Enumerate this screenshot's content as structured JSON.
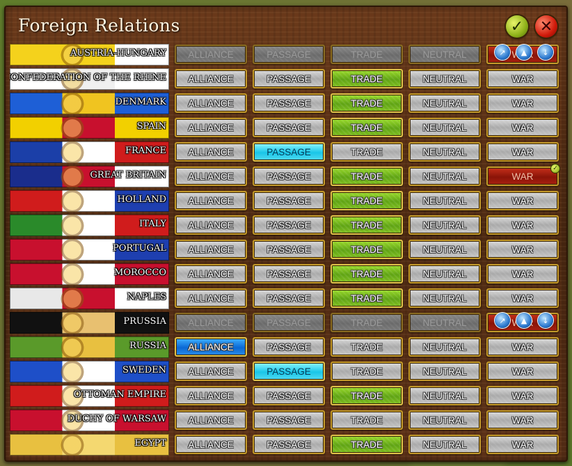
{
  "window": {
    "title": "Foreign Relations",
    "ok_icon": "checkmark-icon",
    "close_icon": "close-x-icon"
  },
  "columns": [
    "ALLIANCE",
    "PASSAGE",
    "TRADE",
    "NEUTRAL",
    "WAR"
  ],
  "colors": {
    "trade_active": "#5fa314",
    "passage_active": "#19c6e8",
    "alliance_active": "#0a68d4",
    "war_active": "#8a1408",
    "inactive": "#a9a9a9"
  },
  "nations": [
    {
      "name": "AUSTRIA-HUNGARY",
      "flag": [
        "#f4d21c",
        "#f4d21c",
        "#ffffff"
      ],
      "states": [
        "disabled",
        "disabled",
        "disabled",
        "disabled",
        "war-icons"
      ]
    },
    {
      "name": "CONFEDERATION OF THE RHINE",
      "flag": [
        "#ffffff",
        "#f0f0f0",
        "#ffffff"
      ],
      "states": [
        "off",
        "off",
        "green",
        "off",
        "off"
      ]
    },
    {
      "name": "DENMARK",
      "flag": [
        "#1e5fd6",
        "#f0c420",
        "#1e5fd6"
      ],
      "states": [
        "off",
        "off",
        "green",
        "off",
        "off"
      ]
    },
    {
      "name": "SPAIN",
      "flag": [
        "#f2d000",
        "#c8102e",
        "#f2d000"
      ],
      "states": [
        "off",
        "off",
        "green",
        "off",
        "off"
      ]
    },
    {
      "name": "FRANCE",
      "flag": [
        "#1b3fa8",
        "#ffffff",
        "#d01c1c"
      ],
      "states": [
        "off",
        "cyan",
        "off",
        "off",
        "off"
      ]
    },
    {
      "name": "GREAT BRITAIN",
      "flag": [
        "#1a2d8c",
        "#c8102e",
        "#ffffff"
      ],
      "states": [
        "off",
        "off",
        "green",
        "off",
        "red"
      ]
    },
    {
      "name": "HOLLAND",
      "flag": [
        "#d01c1c",
        "#ffffff",
        "#1e3fb0"
      ],
      "states": [
        "off",
        "off",
        "green",
        "off",
        "off"
      ]
    },
    {
      "name": "ITALY",
      "flag": [
        "#2a8a2a",
        "#ffffff",
        "#d01c1c"
      ],
      "states": [
        "off",
        "off",
        "green",
        "off",
        "off"
      ]
    },
    {
      "name": "PORTUGAL",
      "flag": [
        "#c8102e",
        "#ffffff",
        "#1e3fb0"
      ],
      "states": [
        "off",
        "off",
        "green",
        "off",
        "off"
      ]
    },
    {
      "name": "MOROCCO",
      "flag": [
        "#c8102e",
        "#ffffff",
        "#c8102e"
      ],
      "states": [
        "off",
        "off",
        "green",
        "off",
        "off"
      ]
    },
    {
      "name": "NAPLES",
      "flag": [
        "#e8e8e8",
        "#c8102e",
        "#ffffff"
      ],
      "states": [
        "off",
        "off",
        "green",
        "off",
        "off"
      ]
    },
    {
      "name": "PRUSSIA",
      "flag": [
        "#111111",
        "#e8c070",
        "#111111"
      ],
      "states": [
        "disabled",
        "disabled",
        "disabled",
        "disabled",
        "war-icons"
      ]
    },
    {
      "name": "RUSSIA",
      "flag": [
        "#5a9a2a",
        "#e8c040",
        "#5a9a2a"
      ],
      "states": [
        "blue",
        "off",
        "off",
        "off",
        "off"
      ]
    },
    {
      "name": "SWEDEN",
      "flag": [
        "#1e4fc8",
        "#ffffff",
        "#1e4fc8"
      ],
      "states": [
        "off",
        "cyan",
        "off",
        "off",
        "off"
      ]
    },
    {
      "name": "OTTOMAN EMPIRE",
      "flag": [
        "#d01c1c",
        "#ffffff",
        "#d01c1c"
      ],
      "states": [
        "off",
        "off",
        "green",
        "off",
        "off"
      ]
    },
    {
      "name": "DUCHY OF WARSAW",
      "flag": [
        "#c8102e",
        "#ffffff",
        "#c8102e"
      ],
      "states": [
        "off",
        "off",
        "off",
        "off",
        "off"
      ]
    },
    {
      "name": "EGYPT",
      "flag": [
        "#e8c040",
        "#f4d870",
        "#e8c040"
      ],
      "states": [
        "off",
        "off",
        "green",
        "off",
        "off"
      ]
    }
  ],
  "war_icon_labels": [
    "↗",
    "▲",
    "↓"
  ]
}
